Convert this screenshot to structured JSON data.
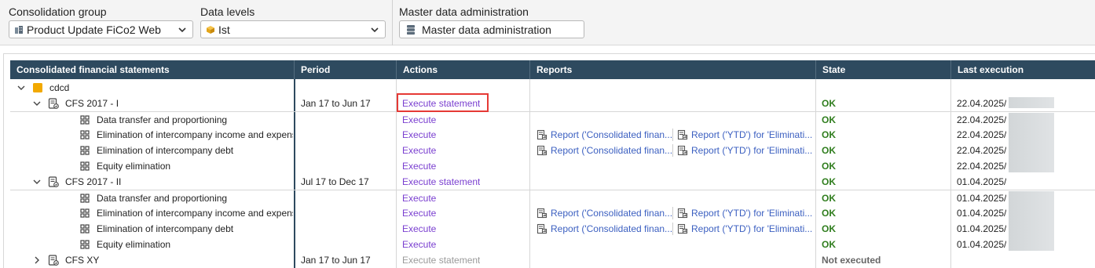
{
  "filters": {
    "consolidation_group_label": "Consolidation group",
    "consolidation_group_value": "Product Update FiCo2 Web",
    "data_levels_label": "Data levels",
    "data_levels_value": "Ist",
    "master_data_label": "Master data administration",
    "master_data_button": "Master data administration"
  },
  "table": {
    "headers": [
      "Consolidated financial statements",
      "Period",
      "Actions",
      "Reports",
      "State",
      "Last execution"
    ],
    "rows": [
      {
        "level": 0,
        "expand": "down",
        "icon": "folder-icon",
        "name": "cdcd",
        "period": "",
        "action": "",
        "report1": "",
        "report2": "",
        "state": "",
        "last": ""
      },
      {
        "level": 1,
        "expand": "down",
        "icon": "statement-icon",
        "name": "CFS 2017 - I",
        "period": "Jan 17 to Jun 17",
        "action": "Execute statement",
        "report1": "",
        "report2": "",
        "state": "OK",
        "last": "22.04.2025/"
      },
      {
        "level": 2,
        "expand": "",
        "icon": "grid-icon",
        "name": "Data transfer and proportioning",
        "period": "",
        "action": "Execute",
        "report1": "",
        "report2": "",
        "state": "OK",
        "last": "22.04.2025/"
      },
      {
        "level": 2,
        "expand": "",
        "icon": "grid-icon",
        "name": "Elimination of intercompany income and expense",
        "period": "",
        "action": "Execute",
        "report1": "Report ('Consolidated finan...",
        "report2": "Report ('YTD') for 'Eliminati...",
        "state": "OK",
        "last": "22.04.2025/"
      },
      {
        "level": 2,
        "expand": "",
        "icon": "grid-icon",
        "name": "Elimination of intercompany debt",
        "period": "",
        "action": "Execute",
        "report1": "Report ('Consolidated finan...",
        "report2": "Report ('YTD') for 'Eliminati...",
        "state": "OK",
        "last": "22.04.2025/"
      },
      {
        "level": 2,
        "expand": "",
        "icon": "grid-icon",
        "name": "Equity elimination",
        "period": "",
        "action": "Execute",
        "report1": "",
        "report2": "",
        "state": "OK",
        "last": "22.04.2025/"
      },
      {
        "level": 1,
        "expand": "down",
        "icon": "statement-icon",
        "name": "CFS 2017 - II",
        "period": "Jul 17 to Dec 17",
        "action": "Execute statement",
        "report1": "",
        "report2": "",
        "state": "OK",
        "last": "01.04.2025/"
      },
      {
        "level": 2,
        "expand": "",
        "icon": "grid-icon",
        "name": "Data transfer and proportioning",
        "period": "",
        "action": "Execute",
        "report1": "",
        "report2": "",
        "state": "OK",
        "last": "01.04.2025/"
      },
      {
        "level": 2,
        "expand": "",
        "icon": "grid-icon",
        "name": "Elimination of intercompany income and expense",
        "period": "",
        "action": "Execute",
        "report1": "Report ('Consolidated finan...",
        "report2": "Report ('YTD') for 'Eliminati...",
        "state": "OK",
        "last": "01.04.2025/"
      },
      {
        "level": 2,
        "expand": "",
        "icon": "grid-icon",
        "name": "Elimination of intercompany debt",
        "period": "",
        "action": "Execute",
        "report1": "Report ('Consolidated finan...",
        "report2": "Report ('YTD') for 'Eliminati...",
        "state": "OK",
        "last": "01.04.2025/"
      },
      {
        "level": 2,
        "expand": "",
        "icon": "grid-icon",
        "name": "Equity elimination",
        "period": "",
        "action": "Execute",
        "report1": "",
        "report2": "",
        "state": "OK",
        "last": "01.04.2025/"
      },
      {
        "level": 1,
        "expand": "right",
        "icon": "statement-icon",
        "name": "CFS XY",
        "period": "Jan 17 to Jun 17",
        "action": "Execute statement",
        "report1": "",
        "report2": "",
        "state": "Not executed",
        "last": ""
      }
    ]
  },
  "colors": {
    "header_bg": "#2e4a5f",
    "link": "#7a3fd0",
    "ok": "#2f7d1d",
    "report": "#3b5fc0",
    "highlight": "#e53935",
    "folder": "#f2a900"
  }
}
